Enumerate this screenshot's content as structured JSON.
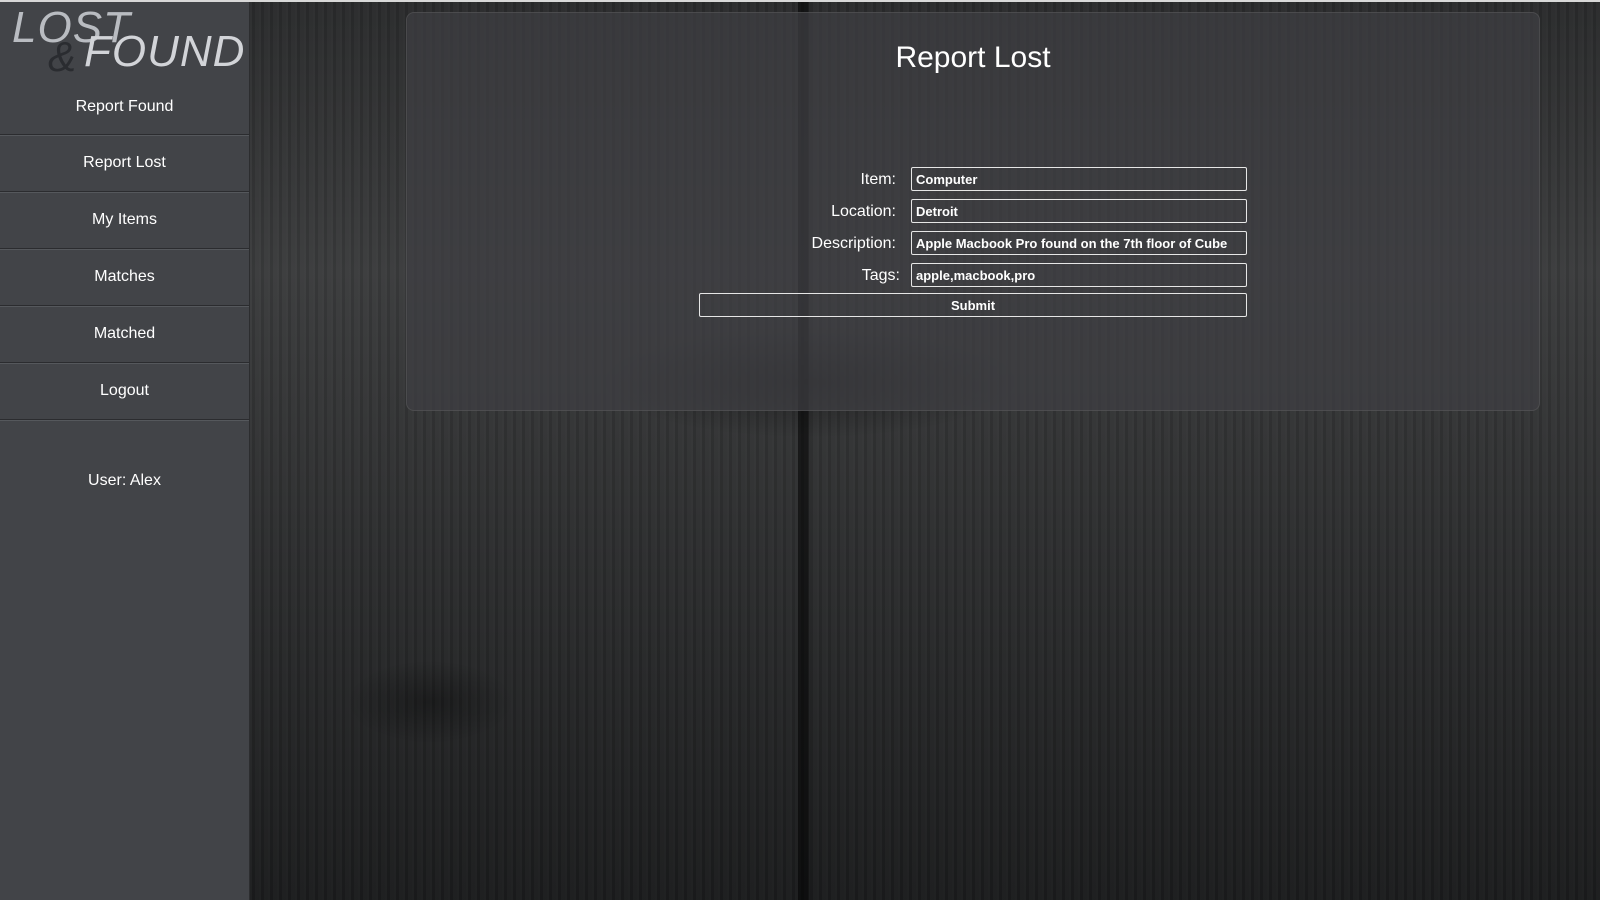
{
  "logo": {
    "lost": "LOST",
    "ampersand": "&",
    "found": "FOUND"
  },
  "sidebar": {
    "items": [
      {
        "label": "Report Found"
      },
      {
        "label": "Report Lost"
      },
      {
        "label": "My Items"
      },
      {
        "label": "Matches"
      },
      {
        "label": "Matched"
      },
      {
        "label": "Logout"
      }
    ],
    "user": "User: Alex"
  },
  "main": {
    "title": "Report Lost",
    "form": {
      "item_label": "Item:",
      "item_value": "Computer",
      "location_label": "Location:",
      "location_value": "Detroit",
      "description_label": "Description:",
      "description_value": "Apple Macbook Pro found on the 7th floor of Cube",
      "tags_label": "Tags:",
      "tags_value": "apple,macbook,pro",
      "submit_label": "Submit"
    }
  }
}
